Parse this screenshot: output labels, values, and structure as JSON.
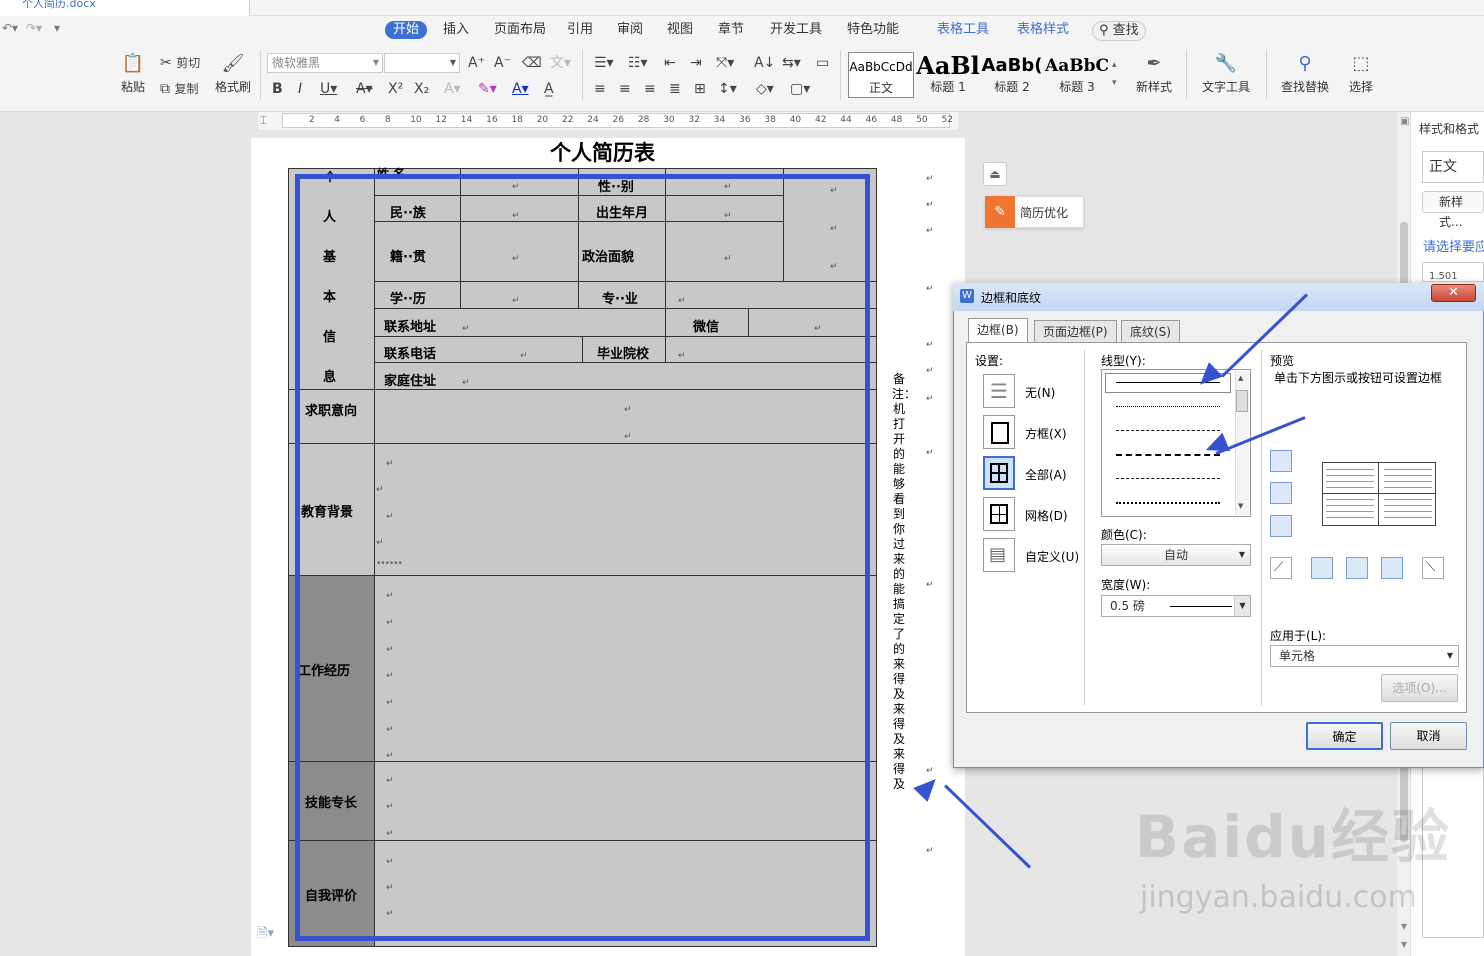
{
  "window": {
    "file_tab": "个人简历.docx"
  },
  "menu": {
    "tabs": [
      "开始",
      "插入",
      "页面布局",
      "引用",
      "审阅",
      "视图",
      "章节",
      "开发工具",
      "特色功能"
    ],
    "context_tabs": [
      "表格工具",
      "表格样式"
    ],
    "search": "查找"
  },
  "ribbon": {
    "paste": "粘贴",
    "cut": "剪切",
    "copy": "复制",
    "format_painter": "格式刷",
    "font_name": "微软雅黑",
    "font_size": "",
    "styles": [
      {
        "sample": "AaBbCcDd",
        "name": "正文"
      },
      {
        "sample": "AaBl",
        "name": "标题 1"
      },
      {
        "sample": "AaBb(",
        "name": "标题 2"
      },
      {
        "sample": "AaBbC",
        "name": "标题 3"
      }
    ],
    "new_style": "新样式",
    "text_tools": "文字工具",
    "find_replace": "查找替换",
    "select": "选择"
  },
  "ruler": {
    "ticks": [
      "2",
      "4",
      "6",
      "8",
      "10",
      "12",
      "14",
      "16",
      "18",
      "20",
      "22",
      "24",
      "26",
      "28",
      "30",
      "32",
      "34",
      "36",
      "38",
      "40",
      "42",
      "44",
      "46",
      "48",
      "50",
      "52"
    ]
  },
  "document": {
    "title": "个人简历表",
    "section_basic": [
      "个",
      "人",
      "基",
      "本",
      "信",
      "息"
    ],
    "labels": {
      "name": "姓  名",
      "gender": "性··别",
      "ethnicity": "民··族",
      "birth": "出生年月",
      "native": "籍··贯",
      "political": "政治面貌",
      "education": "学··历",
      "major": "专··业",
      "address": "联系地址",
      "wechat": "微信",
      "phone": "联系电话",
      "school": "毕业院校",
      "home": "家庭住址"
    },
    "sections": {
      "intent": "求职意向",
      "edu_bg": "教育背景",
      "work": "工作经历",
      "skills": "技能专长",
      "self_eval": "自我评价"
    },
    "edu_dots": "••••••",
    "note": "备注：机打开的能够看到你过来的能搞定了的来得及来得及来得及"
  },
  "resume_opt": "简历优化",
  "right_panel": {
    "title": "样式和格式",
    "current": "正文",
    "new_style": "新样式...",
    "hint": "请选择要应",
    "value": "1.501"
  },
  "dialog": {
    "title": "边框和底纹",
    "tabs": [
      "边框(B)",
      "页面边框(P)",
      "底纹(S)"
    ],
    "settings_label": "设置:",
    "settings": [
      "无(N)",
      "方框(X)",
      "全部(A)",
      "网格(D)",
      "自定义(U)"
    ],
    "line_style_label": "线型(Y):",
    "color_label": "颜色(C):",
    "color_value": "自动",
    "width_label": "宽度(W):",
    "width_value": "0.5  磅",
    "preview_label": "预览",
    "preview_hint": "单击下方图示或按钮可设置边框",
    "apply_label": "应用于(L):",
    "apply_value": "单元格",
    "options": "选项(O)...",
    "ok": "确定",
    "cancel": "取消"
  },
  "watermark": {
    "main": "Baidu经验",
    "sub": "jingyan.baidu.com"
  },
  "colors": {
    "accent": "#3b6fd0",
    "annotation": "#3553d0",
    "dialog_title": "#c3d6f1",
    "close": "#c94a33"
  }
}
